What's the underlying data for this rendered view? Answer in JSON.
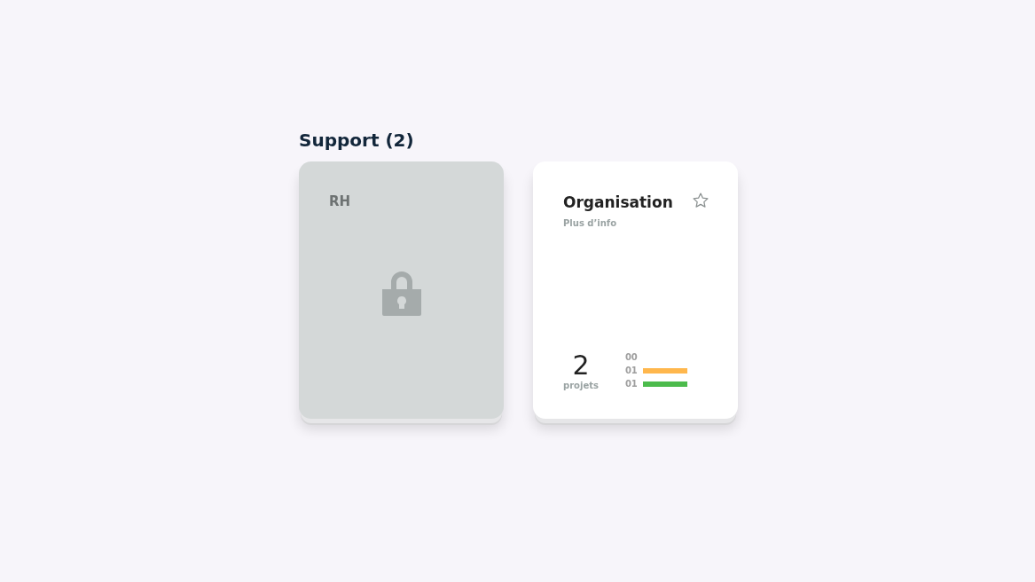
{
  "section": {
    "title": "Support (2)"
  },
  "cards": [
    {
      "kind": "locked",
      "title": "RH"
    },
    {
      "kind": "open",
      "title": "Organisation",
      "starred": false,
      "link": "Plus d’info",
      "count": "2",
      "count_label": "projets",
      "bars": [
        {
          "value": "00"
        },
        {
          "value": "01",
          "color": "#ffb74d"
        },
        {
          "value": "01",
          "color": "#4cbb4c"
        }
      ]
    }
  ]
}
